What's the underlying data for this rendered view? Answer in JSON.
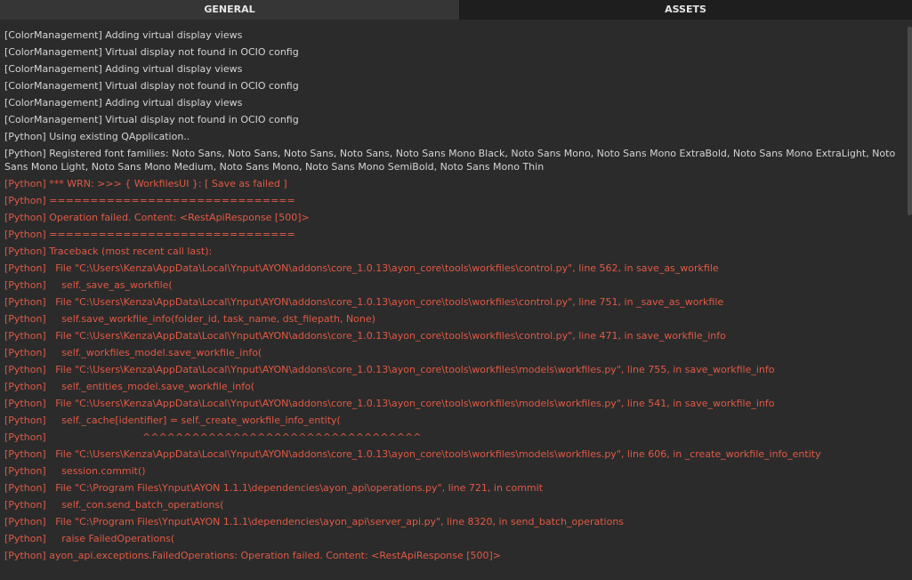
{
  "tabs": {
    "general": "GENERAL",
    "assets": "ASSETS"
  },
  "log_lines": [
    {
      "text": "[ColorManagement] Adding virtual display views",
      "level": "info"
    },
    {
      "text": "[ColorManagement] Virtual display not found in OCIO config",
      "level": "info"
    },
    {
      "text": "[ColorManagement] Adding virtual display views",
      "level": "info"
    },
    {
      "text": "[ColorManagement] Virtual display not found in OCIO config",
      "level": "info"
    },
    {
      "text": "[ColorManagement] Adding virtual display views",
      "level": "info"
    },
    {
      "text": "[ColorManagement] Virtual display not found in OCIO config",
      "level": "info"
    },
    {
      "text": "[Python] Using existing QApplication..",
      "level": "info"
    },
    {
      "text": "[Python] Registered font families: Noto Sans, Noto Sans, Noto Sans, Noto Sans, Noto Sans Mono Black, Noto Sans Mono, Noto Sans Mono ExtraBold, Noto Sans Mono ExtraLight, Noto Sans Mono Light, Noto Sans Mono Medium, Noto Sans Mono, Noto Sans Mono SemiBold, Noto Sans Mono Thin",
      "level": "info",
      "wrap": true
    },
    {
      "text": "[Python] *** WRN: >>> { WorkfilesUI }: [ Save as failed ]",
      "level": "error"
    },
    {
      "text": "[Python] ==============================",
      "level": "error"
    },
    {
      "text": "[Python] Operation failed. Content: <RestApiResponse [500]>",
      "level": "error"
    },
    {
      "text": "[Python] ==============================",
      "level": "error"
    },
    {
      "text": "[Python] Traceback (most recent call last):",
      "level": "error"
    },
    {
      "text": "[Python]   File \"C:\\Users\\Kenza\\AppData\\Local\\Ynput\\AYON\\addons\\core_1.0.13\\ayon_core\\tools\\workfiles\\control.py\", line 562, in save_as_workfile",
      "level": "error"
    },
    {
      "text": "[Python]     self._save_as_workfile(",
      "level": "error"
    },
    {
      "text": "[Python]   File \"C:\\Users\\Kenza\\AppData\\Local\\Ynput\\AYON\\addons\\core_1.0.13\\ayon_core\\tools\\workfiles\\control.py\", line 751, in _save_as_workfile",
      "level": "error"
    },
    {
      "text": "[Python]     self.save_workfile_info(folder_id, task_name, dst_filepath, None)",
      "level": "error"
    },
    {
      "text": "[Python]   File \"C:\\Users\\Kenza\\AppData\\Local\\Ynput\\AYON\\addons\\core_1.0.13\\ayon_core\\tools\\workfiles\\control.py\", line 471, in save_workfile_info",
      "level": "error"
    },
    {
      "text": "[Python]     self._workfiles_model.save_workfile_info(",
      "level": "error"
    },
    {
      "text": "[Python]   File \"C:\\Users\\Kenza\\AppData\\Local\\Ynput\\AYON\\addons\\core_1.0.13\\ayon_core\\tools\\workfiles\\models\\workfiles.py\", line 755, in save_workfile_info",
      "level": "error"
    },
    {
      "text": "[Python]     self._entities_model.save_workfile_info(",
      "level": "error"
    },
    {
      "text": "[Python]   File \"C:\\Users\\Kenza\\AppData\\Local\\Ynput\\AYON\\addons\\core_1.0.13\\ayon_core\\tools\\workfiles\\models\\workfiles.py\", line 541, in save_workfile_info",
      "level": "error"
    },
    {
      "text": "[Python]     self._cache[identifier] = self._create_workfile_info_entity(",
      "level": "error"
    },
    {
      "text": "[Python]                               ^^^^^^^^^^^^^^^^^^^^^^^^^^^^^^^^^^",
      "level": "error"
    },
    {
      "text": "[Python]   File \"C:\\Users\\Kenza\\AppData\\Local\\Ynput\\AYON\\addons\\core_1.0.13\\ayon_core\\tools\\workfiles\\models\\workfiles.py\", line 606, in _create_workfile_info_entity",
      "level": "error"
    },
    {
      "text": "[Python]     session.commit()",
      "level": "error"
    },
    {
      "text": "[Python]   File \"C:\\Program Files\\Ynput\\AYON 1.1.1\\dependencies\\ayon_api\\operations.py\", line 721, in commit",
      "level": "error"
    },
    {
      "text": "[Python]     self._con.send_batch_operations(",
      "level": "error"
    },
    {
      "text": "[Python]   File \"C:\\Program Files\\Ynput\\AYON 1.1.1\\dependencies\\ayon_api\\server_api.py\", line 8320, in send_batch_operations",
      "level": "error"
    },
    {
      "text": "[Python]     raise FailedOperations(",
      "level": "error"
    },
    {
      "text": "[Python] ayon_api.exceptions.FailedOperations: Operation failed. Content: <RestApiResponse [500]>",
      "level": "error"
    }
  ],
  "colors": {
    "info": "#d4d4d4",
    "error": "#e05a45",
    "background": "#2b2b2b"
  }
}
